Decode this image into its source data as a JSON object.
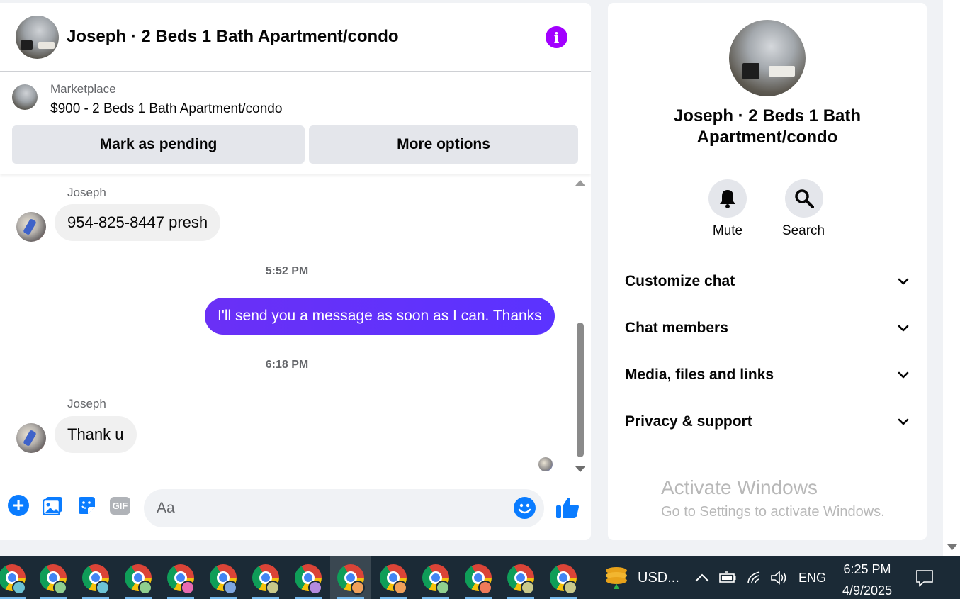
{
  "chat": {
    "title": "Joseph · 2 Beds 1 Bath Apartment/condo",
    "marketplace_label": "Marketplace",
    "listing": "$900 - 2 Beds 1 Bath Apartment/condo",
    "mark_pending_label": "Mark as pending",
    "more_options_label": "More options",
    "messages": [
      {
        "sender": "Joseph",
        "text": "954-825-8447 presh"
      },
      {
        "timestamp": "5:52 PM"
      },
      {
        "sender": "me",
        "text": "I'll send you a message as soon as I can. Thanks"
      },
      {
        "timestamp": "6:18 PM"
      },
      {
        "sender": "Joseph",
        "text": "Thank u"
      }
    ],
    "composer_placeholder": "Aa",
    "gif_label": "GIF",
    "accent_color": "#0a7cff",
    "outgoing_bubble_color": "#5b33ff",
    "info_icon_color": "#a200ff"
  },
  "info_panel": {
    "title": "Joseph · 2 Beds 1 Bath Apartment/condo",
    "mute_label": "Mute",
    "search_label": "Search",
    "sections": [
      "Customize chat",
      "Chat members",
      "Media, files and links",
      "Privacy & support"
    ],
    "watermark_title": "Activate Windows",
    "watermark_sub": "Go to Settings to activate Windows."
  },
  "taskbar": {
    "currency_label": "USD...",
    "language": "ENG",
    "time": "6:25 PM",
    "date": "4/9/2025",
    "apps": [
      {
        "name": "chrome",
        "profile_color": "#6cc3d5"
      },
      {
        "name": "chrome",
        "profile_color": "#8fcf8f"
      },
      {
        "name": "chrome",
        "profile_color": "#6cc3d5"
      },
      {
        "name": "chrome",
        "profile_color": "#8fcf8f"
      },
      {
        "name": "chrome",
        "profile_color": "#e86ab0"
      },
      {
        "name": "chrome",
        "profile_color": "#7ea6e0"
      },
      {
        "name": "chrome",
        "profile_color": "#c9c98a"
      },
      {
        "name": "chrome",
        "profile_color": "#b48be0"
      },
      {
        "name": "chrome",
        "profile_color": "#f0a05a"
      },
      {
        "name": "chrome",
        "profile_color": "#f0a05a"
      },
      {
        "name": "chrome",
        "profile_color": "#8fcf8f"
      },
      {
        "name": "chrome",
        "profile_color": "#f07a5a"
      },
      {
        "name": "chrome",
        "profile_color": "#c9c98a"
      },
      {
        "name": "chrome",
        "profile_color": "#c9c98a"
      }
    ]
  }
}
